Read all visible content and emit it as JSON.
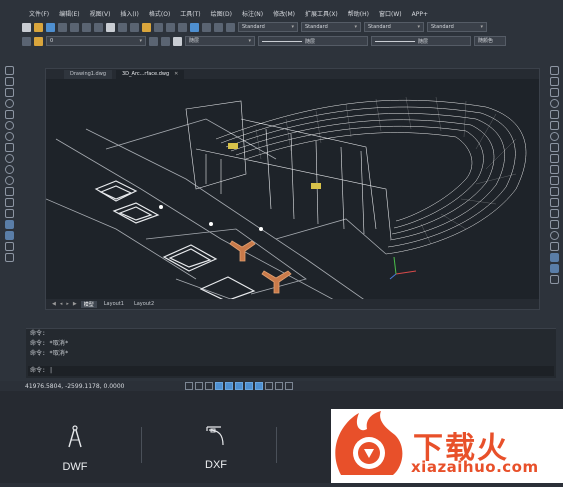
{
  "menubar": {
    "items": [
      "文件(F)",
      "编辑(E)",
      "视图(V)",
      "插入(I)",
      "格式(O)",
      "工具(T)",
      "绘图(D)",
      "标注(N)",
      "修改(M)",
      "扩展工具(X)",
      "帮助(H)",
      "窗口(W)",
      "APP+"
    ]
  },
  "toolbar": {
    "layer_value": "0",
    "color_value": "随层",
    "linetype_value": "随层",
    "lineweight_value": "随层",
    "plotstyle_value": "随颜色",
    "text_style": "Standard",
    "dim_style": "Standard",
    "table_style": "Standard",
    "multileader_style": "Standard"
  },
  "tabs": [
    {
      "label": "Drawing1.dwg"
    },
    {
      "label": "3D_Arc...rface.dwg"
    }
  ],
  "layout_tabs": [
    "模型",
    "Layout1",
    "Layout2"
  ],
  "command": {
    "lines": [
      "命令:",
      "命令: *取消*",
      "命令: *取消*"
    ],
    "prompt": "命令:"
  },
  "status": {
    "coords": "41976.5804, -2599.1178, 0.0000"
  },
  "formats": [
    {
      "label": "DWF",
      "icon": "compass-icon"
    },
    {
      "label": "DXF",
      "icon": "dxf-file-icon"
    }
  ],
  "watermark": {
    "cn": "下载火",
    "en": "xiazaihuo.com"
  },
  "colors": {
    "accent": "#4e8fd0",
    "watermark": "#e8502a"
  }
}
